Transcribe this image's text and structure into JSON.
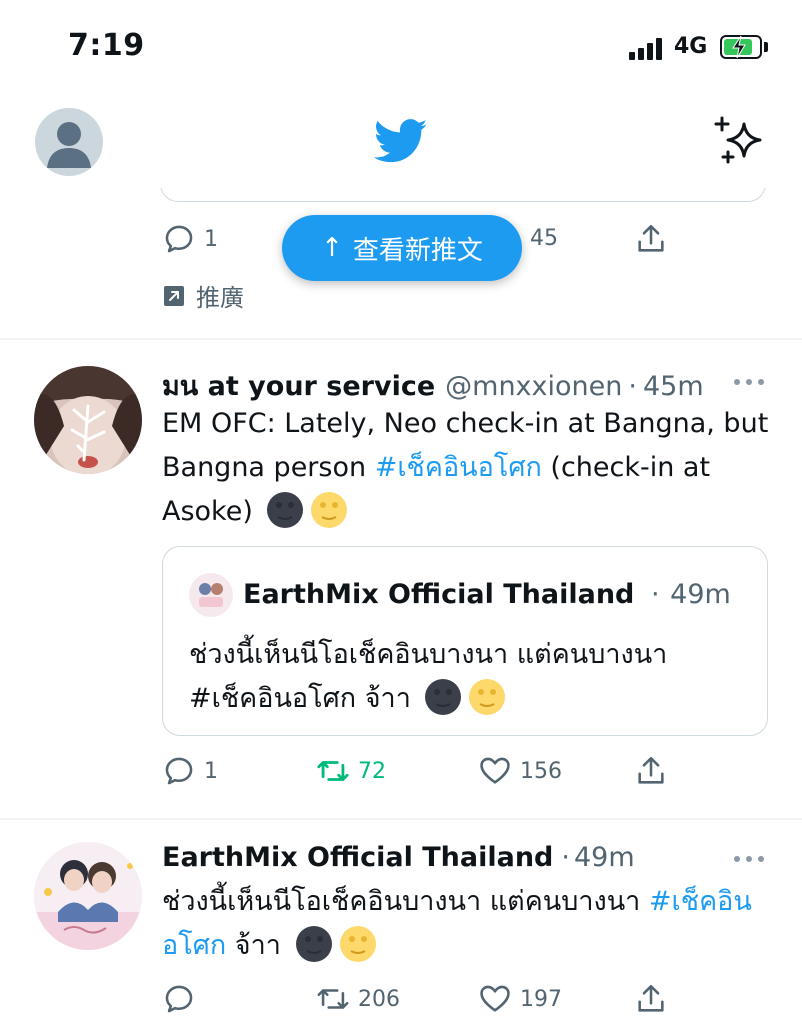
{
  "status_bar": {
    "time": "7:19",
    "network": "4G"
  },
  "header": {
    "avatar_icon": "default-avatar-icon",
    "logo_icon": "twitter-bird-icon",
    "sparkle_icon": "sparkle-icon"
  },
  "previous_tweet": {
    "reply_count": "1",
    "like_count": "45",
    "promoted_label": "推廣"
  },
  "new_tweets_pill": {
    "arrow": "↑",
    "label": "查看新推文"
  },
  "tweet1": {
    "name": "มน at your service",
    "handle": "@mnxxionen",
    "time": "45m",
    "text_before": "EM OFC: Lately, Neo check-in at Bangna, but Bangna person ",
    "hashtag": "#เช็คอินอโศก",
    "text_after": " (check-in at Asoke)",
    "quote": {
      "name": "EarthMix Official Thailand",
      "time": "49m",
      "text": "ช่วงนี้เห็นนีโอเช็คอินบางนา แต่คนบางนา",
      "hashtag": "#เช็คอินอโศก",
      "text_after": " จ้าา"
    },
    "reply_count": "1",
    "retweet_count": "72",
    "like_count": "156"
  },
  "tweet2": {
    "name": "EarthMix Official Thailand",
    "time": "49m",
    "text": "ช่วงนี้เห็นนีโอเช็คอินบางนา แต่คนบางนา ",
    "hashtag": "#เช็คอินอโศก",
    "text_after": " จ้าา",
    "reply_count": "",
    "retweet_count": "206",
    "like_count": "197"
  },
  "colors": {
    "accent": "#1d9bf0",
    "retweet": "#00ba7c",
    "muted": "#536471",
    "border": "#cfd9de"
  }
}
